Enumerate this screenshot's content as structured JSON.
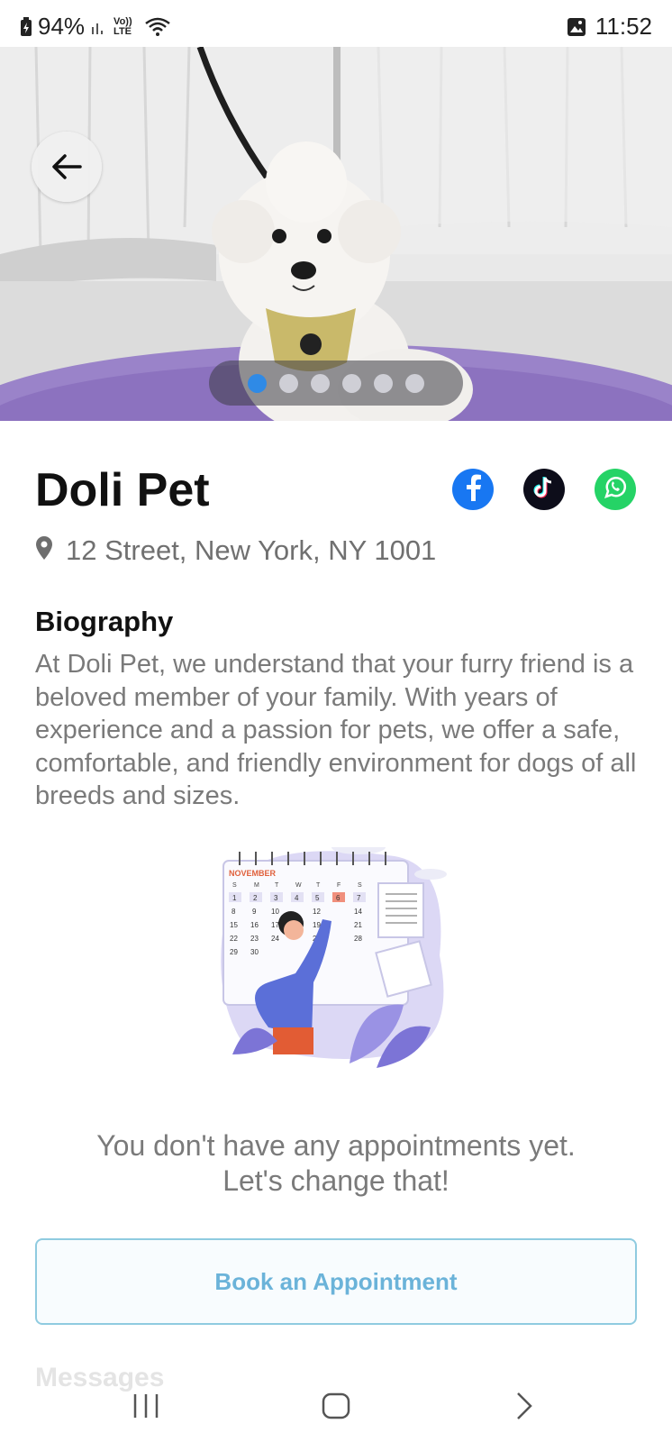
{
  "status_bar": {
    "battery": "94%",
    "network_small": "Vo)) LTE",
    "wifi_label": "6",
    "time": "11:52"
  },
  "hero": {
    "image_alt": "white dog on purple grooming table",
    "slide_count": 6,
    "active_slide": 1
  },
  "business": {
    "name": "Doli Pet",
    "address": "12 Street, New York, NY 1001"
  },
  "socials": [
    {
      "name": "facebook",
      "color": "#1877f2",
      "glyph": "f"
    },
    {
      "name": "tiktok",
      "color": "#0d0d1a",
      "glyph": "♪"
    },
    {
      "name": "whatsapp",
      "color": "#25d366",
      "glyph": "✆"
    }
  ],
  "biography": {
    "heading": "Biography",
    "text": "At Doli Pet, we understand that your furry friend is a beloved member of your family. With years of experience and a passion for pets, we offer a safe, comfortable, and friendly environment for dogs of all breeds and sizes."
  },
  "illustration": {
    "month": "NOVEMBER",
    "weekdays": [
      "S",
      "M",
      "T",
      "W",
      "T",
      "F",
      "S"
    ]
  },
  "appointments": {
    "empty_line1": "You don't have any appointments yet.",
    "empty_line2": "Let's change that!",
    "book_label": "Book an Appointment"
  },
  "messages": {
    "label": "Messages"
  },
  "colors": {
    "accent": "#6bb3d9",
    "active_dot": "#2f8ae6"
  }
}
